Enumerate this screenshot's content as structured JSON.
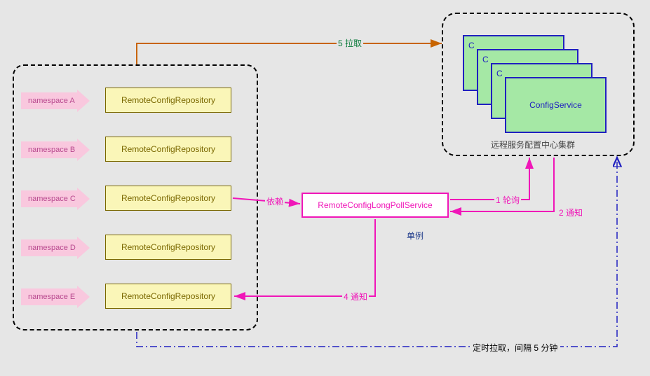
{
  "namespaces": [
    {
      "label": "namespace A",
      "repo": "RemoteConfigRepository"
    },
    {
      "label": "namespace B",
      "repo": "RemoteConfigRepository"
    },
    {
      "label": "namespace C",
      "repo": "RemoteConfigRepository"
    },
    {
      "label": "namespace D",
      "repo": "RemoteConfigRepository"
    },
    {
      "label": "namespace E",
      "repo": "RemoteConfigRepository"
    }
  ],
  "pollService": "RemoteConfigLongPollService",
  "configService": {
    "label": "ConfigService",
    "stackCount": 4
  },
  "clusterLabel": "远程服务配置中心集群",
  "singletonLabel": "单例",
  "edges": {
    "pull": "5 拉取",
    "depend": "依赖",
    "poll": "1 轮询",
    "notifyFromCluster": "2 通知",
    "notifyToRepo": "4 通知",
    "timer": "定时拉取，间隔 5 分钟"
  },
  "colors": {
    "magenta": "#f016b8",
    "orange": "#c86400",
    "blue": "#2020c0",
    "pink": "#f9c8de",
    "yellow": "#faf6b8",
    "green": "#a5e8a5"
  }
}
